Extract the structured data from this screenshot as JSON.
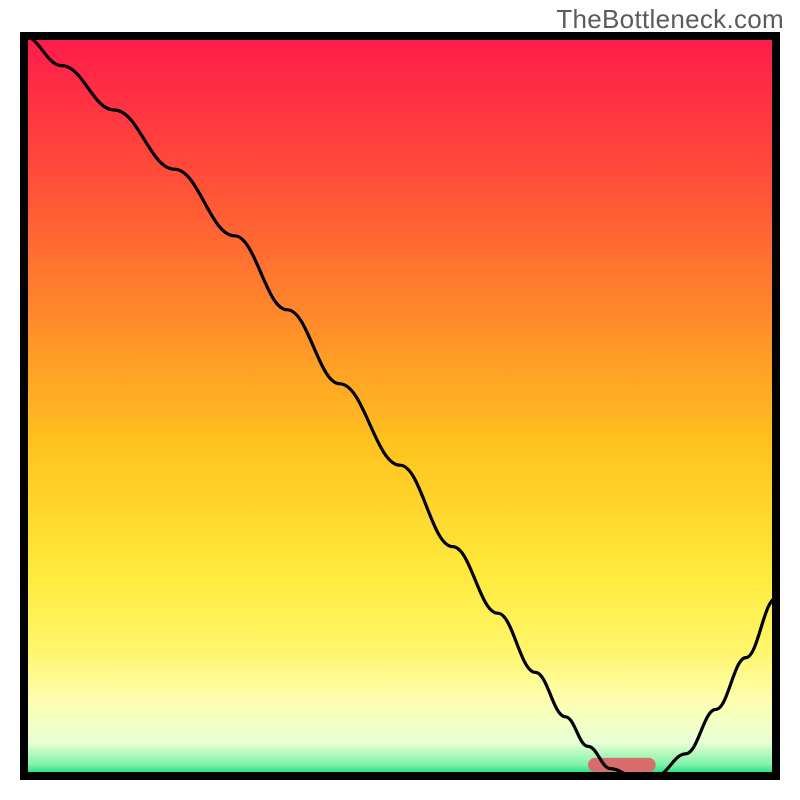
{
  "watermark": "TheBottleneck.com",
  "chart_data": {
    "type": "line",
    "title": "",
    "xlabel": "",
    "ylabel": "",
    "xlim": [
      0,
      100
    ],
    "ylim": [
      0,
      100
    ],
    "grid": false,
    "legend": false,
    "series": [
      {
        "name": "curve",
        "x": [
          0,
          5,
          12,
          20,
          28,
          35,
          42,
          50,
          57,
          63,
          68,
          72,
          75,
          78,
          81,
          84,
          88,
          92,
          96,
          100
        ],
        "y": [
          100,
          96,
          90,
          82,
          73,
          63,
          53,
          42,
          31,
          22,
          14,
          8,
          4,
          1,
          0,
          0,
          3,
          9,
          16,
          24
        ]
      }
    ],
    "plateau_bar": {
      "x_start": 75,
      "x_end": 84,
      "y": 1.5,
      "color": "#d96d6d"
    },
    "gradient_stops": [
      {
        "offset": 0.0,
        "color": "#ff1a4b"
      },
      {
        "offset": 0.18,
        "color": "#ff4a3a"
      },
      {
        "offset": 0.38,
        "color": "#ff8a2a"
      },
      {
        "offset": 0.55,
        "color": "#ffc21f"
      },
      {
        "offset": 0.72,
        "color": "#ffe93a"
      },
      {
        "offset": 0.83,
        "color": "#fff66a"
      },
      {
        "offset": 0.9,
        "color": "#ffffb3"
      },
      {
        "offset": 0.955,
        "color": "#e7ffd4"
      },
      {
        "offset": 0.985,
        "color": "#7ef2a8"
      },
      {
        "offset": 1.0,
        "color": "#00d873"
      }
    ],
    "border_color": "#000000",
    "border_width": 8
  }
}
